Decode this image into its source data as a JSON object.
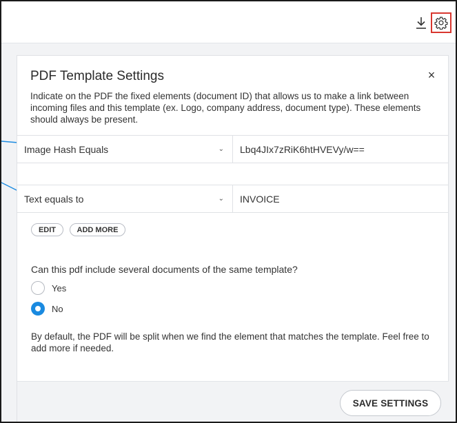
{
  "toolbar": {
    "download_icon": "download-icon",
    "settings_icon": "gear-icon",
    "highlight_color": "#d8372f"
  },
  "panel": {
    "title": "PDF Template Settings",
    "close_glyph": "×",
    "description": "Indicate on the PDF the fixed elements (document ID) that allows us to make a link between incoming files and this template (ex. Logo, company address, document type). These elements should always be present.",
    "rules": [
      {
        "condition": "Image Hash Equals",
        "value": "Lbq4JIx7zRiK6htHVEVy/w=="
      },
      {
        "condition": "Text equals to",
        "value": "INVOICE"
      }
    ],
    "edit_label": "EDIT",
    "add_more_label": "ADD MORE",
    "question": "Can this pdf include several documents of the same template?",
    "options": [
      {
        "label": "Yes",
        "selected": false
      },
      {
        "label": "No",
        "selected": true
      }
    ],
    "footnote": "By default, the PDF will be split when we find the element that matches the template. Feel free to add more if needed.",
    "save_label": "SAVE SETTINGS"
  },
  "colors": {
    "accent": "#1a8ae0",
    "connector": "#1a8ae0"
  }
}
